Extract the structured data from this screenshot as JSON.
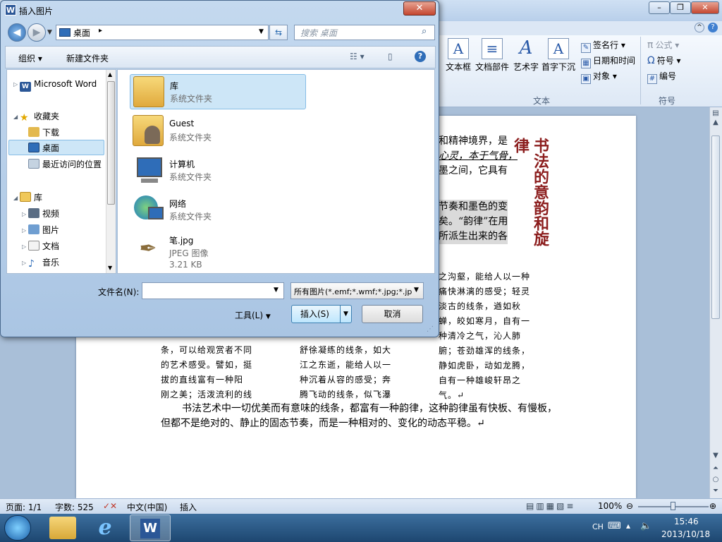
{
  "word": {
    "ribbon_buttons": [
      "文本框",
      "文档部件",
      "艺术字",
      "首字下沉"
    ],
    "ribbon_small": [
      "签名行",
      "日期和时间",
      "对象"
    ],
    "ribbon_symbols": [
      "公式",
      "符号",
      "编号"
    ],
    "group_text_label": "文本",
    "group_symbol_label": "符号"
  },
  "document": {
    "lines_top": [
      "和精神境界，是",
      "心灵，本于气骨，",
      "墨之间，它具有",
      "节奏和墨色的变",
      "矣。“韵律”在用",
      "所派生出来的各"
    ],
    "vertical_title": "书法的意韵和旋律",
    "col_right": [
      "之沟壑，能给人以一种",
      "痛快淋漓的感受；轻灵",
      "淡古的线条，遒如秋",
      "蝉，皎如寒月，自有一",
      "种清冷之气，沁人肺",
      "腑；苍劲雄浑的线条，",
      "静如虎卧，动如龙腾，",
      "自有一种雄峻轩昂之",
      "气。↵"
    ],
    "col_left": [
      "条，可以给观赏者不同",
      "的艺术感受。譬如，挺",
      "拔的直线富有一种阳",
      "刚之美；活泼流利的线"
    ],
    "col_mid": [
      "舒徐凝练的线条，如大",
      "江之东逝，能给人以一",
      "种沉着从容的感受；奔",
      "腾飞动的线条，似飞瀑"
    ],
    "para_line1": "书法艺术中一切优美而有意味的线条，都富有一种韵律，这种韵律虽有快板、有慢板，",
    "para_line2": "但都不是绝对的、静止的固态节奏，而是一种相对的、变化的动态平稳。↵"
  },
  "statusbar": {
    "page": "页面: 1/1",
    "words": "字数: 525",
    "language": "中文(中国)",
    "mode": "插入",
    "zoom": "100%"
  },
  "taskbar": {
    "ime": "CH",
    "time": "15:46",
    "date": "2013/10/18"
  },
  "dialog": {
    "title": "插入图片",
    "close": "✕",
    "address": "桌面",
    "search_placeholder": "搜索 桌面",
    "toolbar": {
      "organize": "组织 ▾",
      "new_folder": "新建文件夹"
    },
    "nav": [
      {
        "label": "Microsoft Word",
        "icon": "word-icon",
        "level": 0
      },
      {
        "label": "收藏夹",
        "icon": "star-icon",
        "level": 0
      },
      {
        "label": "下载",
        "icon": "download-folder-icon",
        "level": 1
      },
      {
        "label": "桌面",
        "icon": "desktop-icon",
        "level": 1,
        "selected": true
      },
      {
        "label": "最近访问的位置",
        "icon": "recent-places-icon",
        "level": 1
      },
      {
        "label": "库",
        "icon": "library-icon",
        "level": 0
      },
      {
        "label": "视频",
        "icon": "video-library-icon",
        "level": 1
      },
      {
        "label": "图片",
        "icon": "pictures-library-icon",
        "level": 1
      },
      {
        "label": "文档",
        "icon": "documents-library-icon",
        "level": 1
      },
      {
        "label": "音乐",
        "icon": "music-library-icon",
        "level": 1
      }
    ],
    "files": [
      {
        "name": "库",
        "desc": "系统文件夹",
        "icon": "library-folder-icon",
        "selected": true
      },
      {
        "name": "Guest",
        "desc": "系统文件夹",
        "icon": "user-folder-icon"
      },
      {
        "name": "计算机",
        "desc": "系统文件夹",
        "icon": "computer-icon"
      },
      {
        "name": "网络",
        "desc": "系统文件夹",
        "icon": "network-icon"
      },
      {
        "name": "笔.jpg",
        "desc": "JPEG 图像",
        "size": "3.21 KB",
        "icon": "image-file-icon"
      }
    ],
    "filename_label": "文件名(N):",
    "filename_value": "",
    "filetype": "所有图片(*.emf;*.wmf;*.jpg;*.jp",
    "tools": "工具(L)",
    "insert": "插入(S)",
    "cancel": "取消",
    "colors": {
      "title_bg": "#b9d1ea",
      "selected": "#cde6f7",
      "close": "#c4462f"
    }
  }
}
